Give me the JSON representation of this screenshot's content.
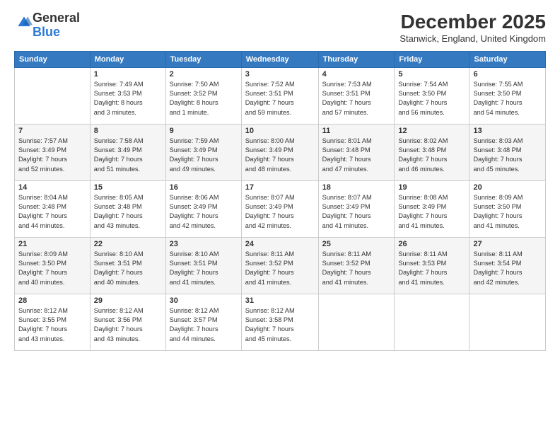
{
  "logo": {
    "general": "General",
    "blue": "Blue"
  },
  "header": {
    "month_title": "December 2025",
    "location": "Stanwick, England, United Kingdom"
  },
  "weekdays": [
    "Sunday",
    "Monday",
    "Tuesday",
    "Wednesday",
    "Thursday",
    "Friday",
    "Saturday"
  ],
  "weeks": [
    [
      {
        "day": "",
        "info": ""
      },
      {
        "day": "1",
        "info": "Sunrise: 7:49 AM\nSunset: 3:53 PM\nDaylight: 8 hours\nand 3 minutes."
      },
      {
        "day": "2",
        "info": "Sunrise: 7:50 AM\nSunset: 3:52 PM\nDaylight: 8 hours\nand 1 minute."
      },
      {
        "day": "3",
        "info": "Sunrise: 7:52 AM\nSunset: 3:51 PM\nDaylight: 7 hours\nand 59 minutes."
      },
      {
        "day": "4",
        "info": "Sunrise: 7:53 AM\nSunset: 3:51 PM\nDaylight: 7 hours\nand 57 minutes."
      },
      {
        "day": "5",
        "info": "Sunrise: 7:54 AM\nSunset: 3:50 PM\nDaylight: 7 hours\nand 56 minutes."
      },
      {
        "day": "6",
        "info": "Sunrise: 7:55 AM\nSunset: 3:50 PM\nDaylight: 7 hours\nand 54 minutes."
      }
    ],
    [
      {
        "day": "7",
        "info": "Sunrise: 7:57 AM\nSunset: 3:49 PM\nDaylight: 7 hours\nand 52 minutes."
      },
      {
        "day": "8",
        "info": "Sunrise: 7:58 AM\nSunset: 3:49 PM\nDaylight: 7 hours\nand 51 minutes."
      },
      {
        "day": "9",
        "info": "Sunrise: 7:59 AM\nSunset: 3:49 PM\nDaylight: 7 hours\nand 49 minutes."
      },
      {
        "day": "10",
        "info": "Sunrise: 8:00 AM\nSunset: 3:49 PM\nDaylight: 7 hours\nand 48 minutes."
      },
      {
        "day": "11",
        "info": "Sunrise: 8:01 AM\nSunset: 3:48 PM\nDaylight: 7 hours\nand 47 minutes."
      },
      {
        "day": "12",
        "info": "Sunrise: 8:02 AM\nSunset: 3:48 PM\nDaylight: 7 hours\nand 46 minutes."
      },
      {
        "day": "13",
        "info": "Sunrise: 8:03 AM\nSunset: 3:48 PM\nDaylight: 7 hours\nand 45 minutes."
      }
    ],
    [
      {
        "day": "14",
        "info": "Sunrise: 8:04 AM\nSunset: 3:48 PM\nDaylight: 7 hours\nand 44 minutes."
      },
      {
        "day": "15",
        "info": "Sunrise: 8:05 AM\nSunset: 3:48 PM\nDaylight: 7 hours\nand 43 minutes."
      },
      {
        "day": "16",
        "info": "Sunrise: 8:06 AM\nSunset: 3:49 PM\nDaylight: 7 hours\nand 42 minutes."
      },
      {
        "day": "17",
        "info": "Sunrise: 8:07 AM\nSunset: 3:49 PM\nDaylight: 7 hours\nand 42 minutes."
      },
      {
        "day": "18",
        "info": "Sunrise: 8:07 AM\nSunset: 3:49 PM\nDaylight: 7 hours\nand 41 minutes."
      },
      {
        "day": "19",
        "info": "Sunrise: 8:08 AM\nSunset: 3:49 PM\nDaylight: 7 hours\nand 41 minutes."
      },
      {
        "day": "20",
        "info": "Sunrise: 8:09 AM\nSunset: 3:50 PM\nDaylight: 7 hours\nand 41 minutes."
      }
    ],
    [
      {
        "day": "21",
        "info": "Sunrise: 8:09 AM\nSunset: 3:50 PM\nDaylight: 7 hours\nand 40 minutes."
      },
      {
        "day": "22",
        "info": "Sunrise: 8:10 AM\nSunset: 3:51 PM\nDaylight: 7 hours\nand 40 minutes."
      },
      {
        "day": "23",
        "info": "Sunrise: 8:10 AM\nSunset: 3:51 PM\nDaylight: 7 hours\nand 41 minutes."
      },
      {
        "day": "24",
        "info": "Sunrise: 8:11 AM\nSunset: 3:52 PM\nDaylight: 7 hours\nand 41 minutes."
      },
      {
        "day": "25",
        "info": "Sunrise: 8:11 AM\nSunset: 3:52 PM\nDaylight: 7 hours\nand 41 minutes."
      },
      {
        "day": "26",
        "info": "Sunrise: 8:11 AM\nSunset: 3:53 PM\nDaylight: 7 hours\nand 41 minutes."
      },
      {
        "day": "27",
        "info": "Sunrise: 8:11 AM\nSunset: 3:54 PM\nDaylight: 7 hours\nand 42 minutes."
      }
    ],
    [
      {
        "day": "28",
        "info": "Sunrise: 8:12 AM\nSunset: 3:55 PM\nDaylight: 7 hours\nand 43 minutes."
      },
      {
        "day": "29",
        "info": "Sunrise: 8:12 AM\nSunset: 3:56 PM\nDaylight: 7 hours\nand 43 minutes."
      },
      {
        "day": "30",
        "info": "Sunrise: 8:12 AM\nSunset: 3:57 PM\nDaylight: 7 hours\nand 44 minutes."
      },
      {
        "day": "31",
        "info": "Sunrise: 8:12 AM\nSunset: 3:58 PM\nDaylight: 7 hours\nand 45 minutes."
      },
      {
        "day": "",
        "info": ""
      },
      {
        "day": "",
        "info": ""
      },
      {
        "day": "",
        "info": ""
      }
    ]
  ]
}
